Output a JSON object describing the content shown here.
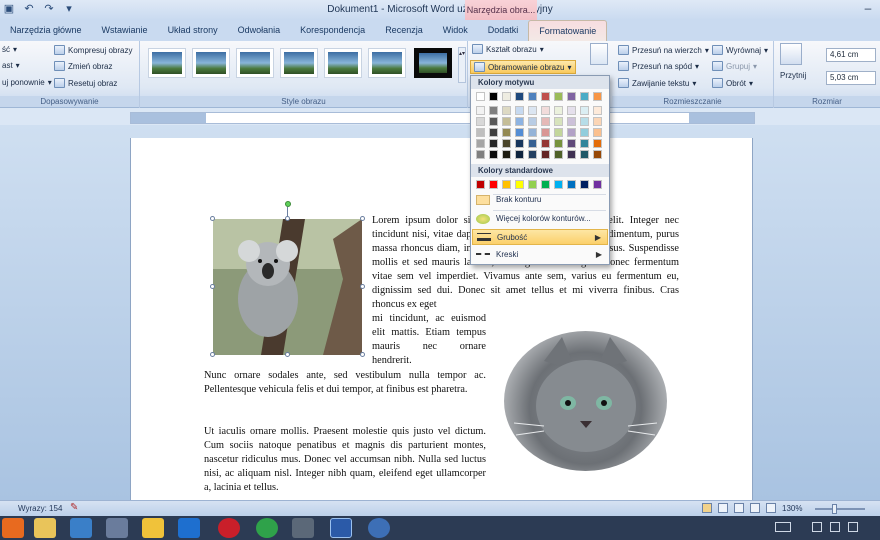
{
  "window": {
    "title": "Dokument1 - Microsoft Word użytek niekomercyjny",
    "context_title": "Narzędzia obra..."
  },
  "tabs": [
    {
      "label": "Narzędzia główne"
    },
    {
      "label": "Wstawianie"
    },
    {
      "label": "Układ strony"
    },
    {
      "label": "Odwołania"
    },
    {
      "label": "Korespondencja"
    },
    {
      "label": "Recenzja"
    },
    {
      "label": "Widok"
    },
    {
      "label": "Dodatki"
    },
    {
      "label": "Formatowanie"
    }
  ],
  "ribbon": {
    "adjust": {
      "label": "Dopasowywanie",
      "left_items": [
        "ść",
        "ast",
        "uj ponownie"
      ],
      "compress": "Kompresuj obrazy",
      "change": "Zmień obraz",
      "reset": "Resetuj obraz"
    },
    "styles": {
      "label": "Style obrazu",
      "shape": "Kształt obrazu",
      "border": "Obramowanie obrazu"
    },
    "arrange": {
      "label": "Rozmieszczanie",
      "front": "Przesuń na wierzch",
      "back": "Przesuń na spód",
      "wrap": "Zawijanie tekstu",
      "align": "Wyrównaj",
      "group": "Grupuj",
      "rotate": "Obrót"
    },
    "size": {
      "label": "Rozmiar",
      "crop": "Przytnij",
      "height": "4,61 cm",
      "width": "5,03 cm"
    }
  },
  "dropdown": {
    "theme_header": "Kolory motywu",
    "standard_header": "Kolory standardowe",
    "no_outline": "Brak konturu",
    "more_colors": "Więcej kolorów konturów...",
    "weight": "Grubość",
    "dashes": "Kreski",
    "theme_top": [
      "#ffffff",
      "#000000",
      "#eeece1",
      "#1f497d",
      "#4f81bd",
      "#c0504d",
      "#9bbb59",
      "#8064a2",
      "#4bacc6",
      "#f79646"
    ],
    "theme_shades": [
      [
        "#f2f2f2",
        "#7f7f7f",
        "#ddd9c3",
        "#c6d9f0",
        "#dbe5f1",
        "#f2dcdb",
        "#ebf1dd",
        "#e5e0ec",
        "#dbeef3",
        "#fdeada"
      ],
      [
        "#d8d8d8",
        "#595959",
        "#c4bd97",
        "#8db3e2",
        "#b8cce4",
        "#e5b9b7",
        "#d7e3bc",
        "#ccc1d9",
        "#b7dde8",
        "#fbd5b5"
      ],
      [
        "#bfbfbf",
        "#3f3f3f",
        "#938953",
        "#548dd4",
        "#95b3d7",
        "#d99694",
        "#c3d69b",
        "#b2a2c7",
        "#92cddc",
        "#fac08f"
      ],
      [
        "#a5a5a5",
        "#262626",
        "#494429",
        "#17365d",
        "#366092",
        "#953734",
        "#76923c",
        "#5f497a",
        "#31859b",
        "#e36c09"
      ],
      [
        "#7f7f7f",
        "#0c0c0c",
        "#1d1b10",
        "#0f243e",
        "#244061",
        "#632423",
        "#4f6128",
        "#3f3151",
        "#205867",
        "#974806"
      ]
    ],
    "standard": [
      "#c00000",
      "#ff0000",
      "#ffc000",
      "#ffff00",
      "#92d050",
      "#00b050",
      "#00b0f0",
      "#0070c0",
      "#002060",
      "#7030a0"
    ]
  },
  "doc": {
    "para1_right": "Lorem ipsum dolor sit amet, consectetur adipiscing elit. Integer nec tincidunt nisi, vitae dapibus quam. Duis in pulvinar condimentum, purus massa rhoncus diam, in pulvinar convallis ante est eu risus. Suspendisse mollis et sed mauris lacinia, et congue felis congue. Donec fermentum vitae sem vel imperdiet. Vivamus ante sem, varius eu fermentum eu, dignissim sed dui. Donec sit amet tellus et mi viverra finibus. Cras rhoncus ex eget",
    "para1_narrow": "mi tincidunt, ac euismod elit mattis. Etiam tempus mauris nec ornare hendrerit.",
    "para1_full": "Nunc ornare sodales ante, sed vestibulum nulla tempor ac. Pellentesque vehicula felis et dui tempor, at finibus est pharetra.",
    "para2": "Ut iaculis ornare mollis. Praesent molestie quis justo vel dictum. Cum sociis natoque penatibus et magnis dis parturient montes, nascetur ridiculus mus. Donec vel accumsan nibh. Nulla sed luctus nisi, ac aliquam nisl. Integer nibh quam, eleifend eget ullamcorper a, lacinia et tellus."
  },
  "status": {
    "words": "Wyrazy: 154",
    "zoom": "130%"
  }
}
